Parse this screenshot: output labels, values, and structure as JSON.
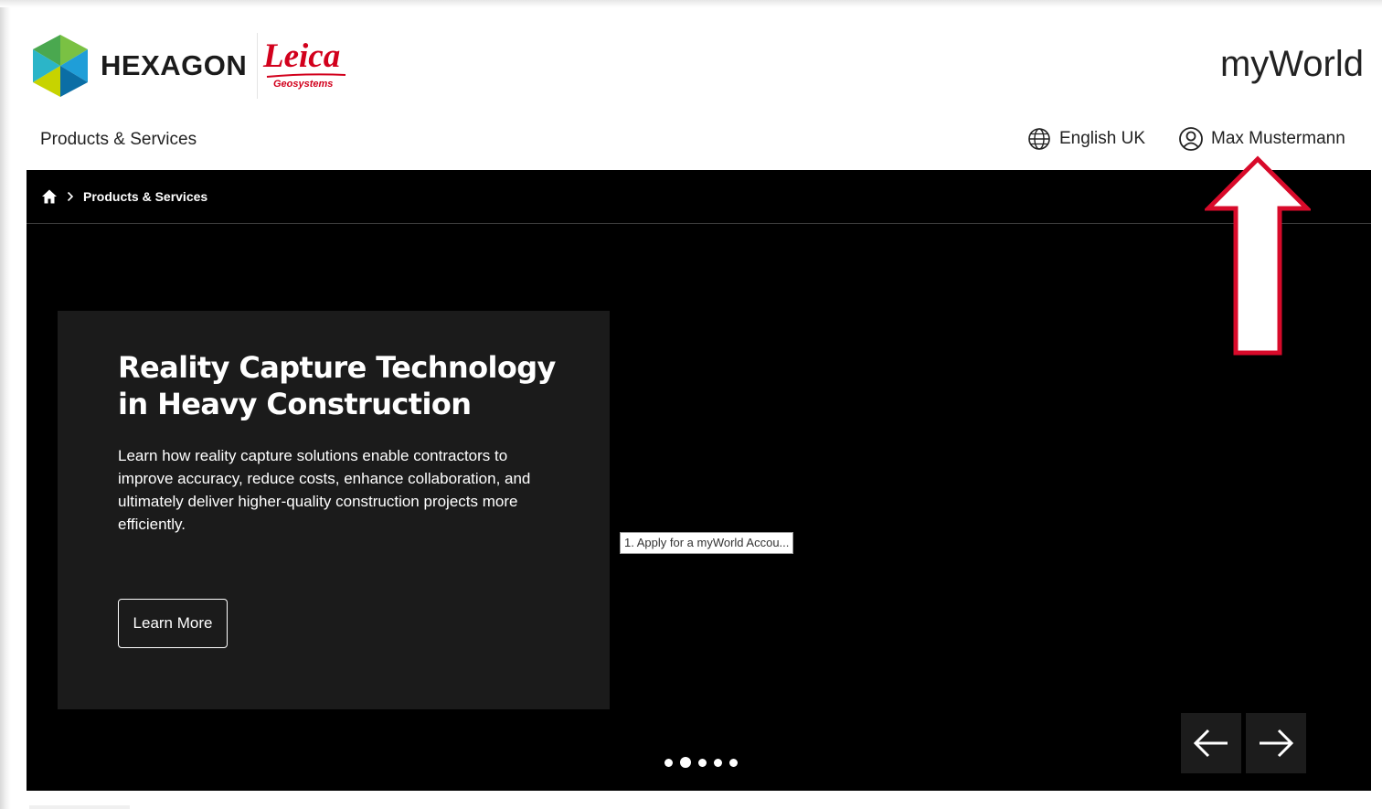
{
  "header": {
    "hexagon_logo_text": "HEXAGON",
    "leica_logo_text": "Leica",
    "leica_logo_sub": "Geosystems",
    "app_title": "myWorld"
  },
  "nav": {
    "products_services": "Products & Services",
    "language": "English UK",
    "user_name": "Max Mustermann"
  },
  "hero": {
    "breadcrumb": {
      "current": "Products & Services"
    },
    "card": {
      "title": "Reality Capture Technology in Heavy Construction",
      "body": "Learn how reality capture solutions enable contractors to improve accuracy, reduce costs, enhance collaboration, and ultimately deliver higher-quality construction projects more efficiently.",
      "button_label": "Learn More"
    },
    "tooltip": "1. Apply for a myWorld Accou...",
    "slides": {
      "count": 5,
      "active_index": 1
    }
  },
  "colors": {
    "leica_red": "#d2001c",
    "annotation_red": "#d80a2a",
    "hero_bg": "#000000",
    "card_bg": "#1b1b1b"
  }
}
